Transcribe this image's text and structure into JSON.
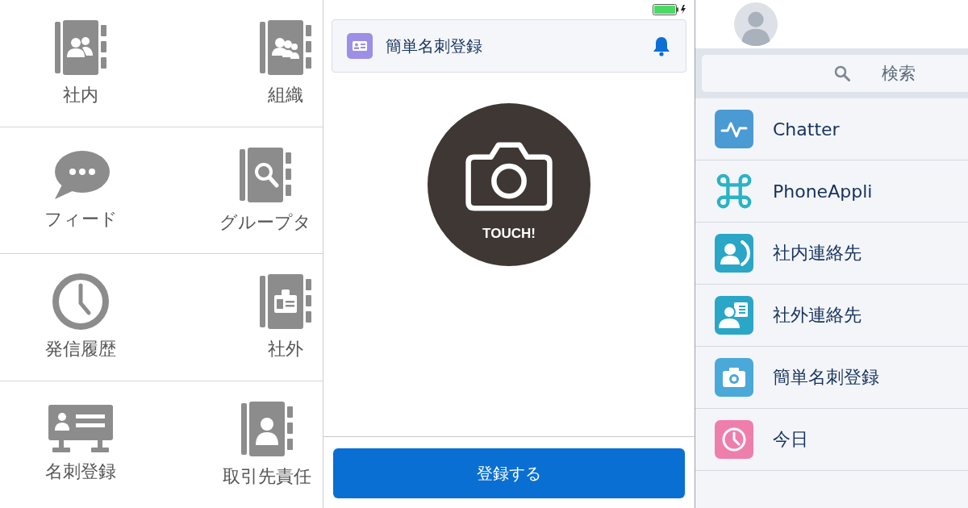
{
  "left_grid": {
    "items": [
      {
        "label": "社内",
        "kind": "contacts"
      },
      {
        "label": "組織",
        "kind": "organization"
      },
      {
        "label": "フィード",
        "kind": "feed"
      },
      {
        "label": "グループタ",
        "kind": "search"
      },
      {
        "label": "発信履歴",
        "kind": "history"
      },
      {
        "label": "社外",
        "kind": "external"
      },
      {
        "label": "名刺登録",
        "kind": "card"
      },
      {
        "label": "取引先責任",
        "kind": "client"
      }
    ]
  },
  "card_screen": {
    "header": {
      "title": "簡単名刺登録"
    },
    "camera_button": {
      "label": "TOUCH!"
    },
    "submit_button": {
      "label": "登録する"
    }
  },
  "menu": {
    "search": {
      "placeholder": "検索"
    },
    "items": [
      {
        "label": "Chatter",
        "kind": "pulse",
        "color": "#4a9ad4"
      },
      {
        "label": "PhoneAppli",
        "kind": "command",
        "color": "#2bb3c4"
      },
      {
        "label": "社内連絡先",
        "kind": "internal",
        "color": "#2aa6c6"
      },
      {
        "label": "社外連絡先",
        "kind": "external",
        "color": "#2aa6c6"
      },
      {
        "label": "簡単名刺登録",
        "kind": "camera",
        "color": "#4aa9d8"
      },
      {
        "label": "今日",
        "kind": "clock",
        "color": "#ee7fad"
      }
    ]
  }
}
